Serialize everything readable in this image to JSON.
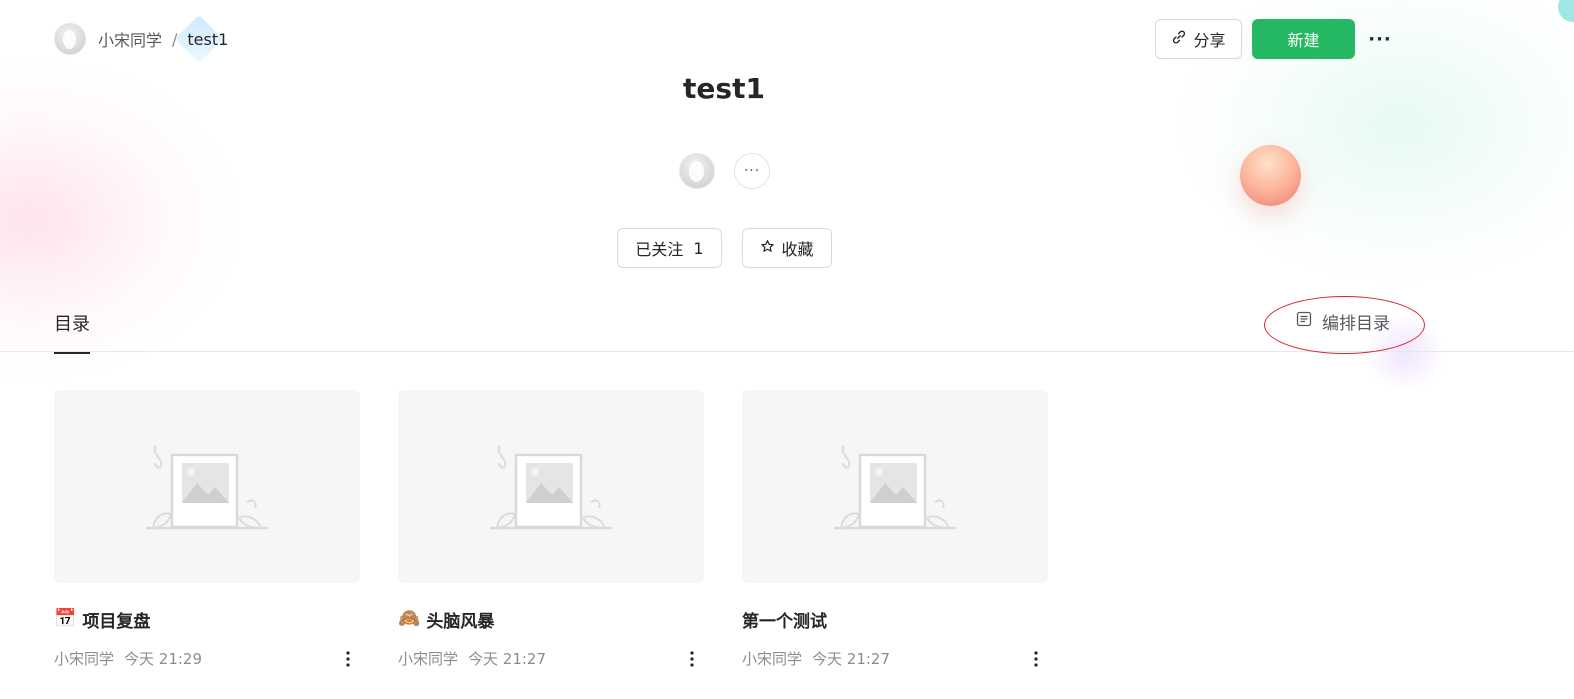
{
  "breadcrumb": {
    "owner": "小宋同学",
    "separator": "/",
    "current": "test1"
  },
  "header": {
    "share_label": "分享",
    "new_label": "新建",
    "more_label": "···"
  },
  "book": {
    "title": "test1",
    "members_more": "···",
    "follow_label": "已关注",
    "follow_count": "1",
    "collect_label": "收藏"
  },
  "tabs": {
    "active": "目录",
    "edit_toc_label": "编排目录"
  },
  "docs": [
    {
      "icon": "calendar-emoji-icon",
      "emoji": "📅",
      "title": "项目复盘",
      "author": "小宋同学",
      "time": "今天 21:29"
    },
    {
      "icon": "monkey-emoji-icon",
      "emoji": "🙈",
      "title": "头脑风暴",
      "author": "小宋同学",
      "time": "今天 21:27"
    },
    {
      "icon": "",
      "emoji": "",
      "title": "第一个测试",
      "author": "小宋同学",
      "time": "今天 21:27"
    }
  ],
  "colors": {
    "primary_green": "#25b864",
    "annotation_red": "#d8242f",
    "text": "#262626",
    "muted": "#8a8f8d"
  }
}
